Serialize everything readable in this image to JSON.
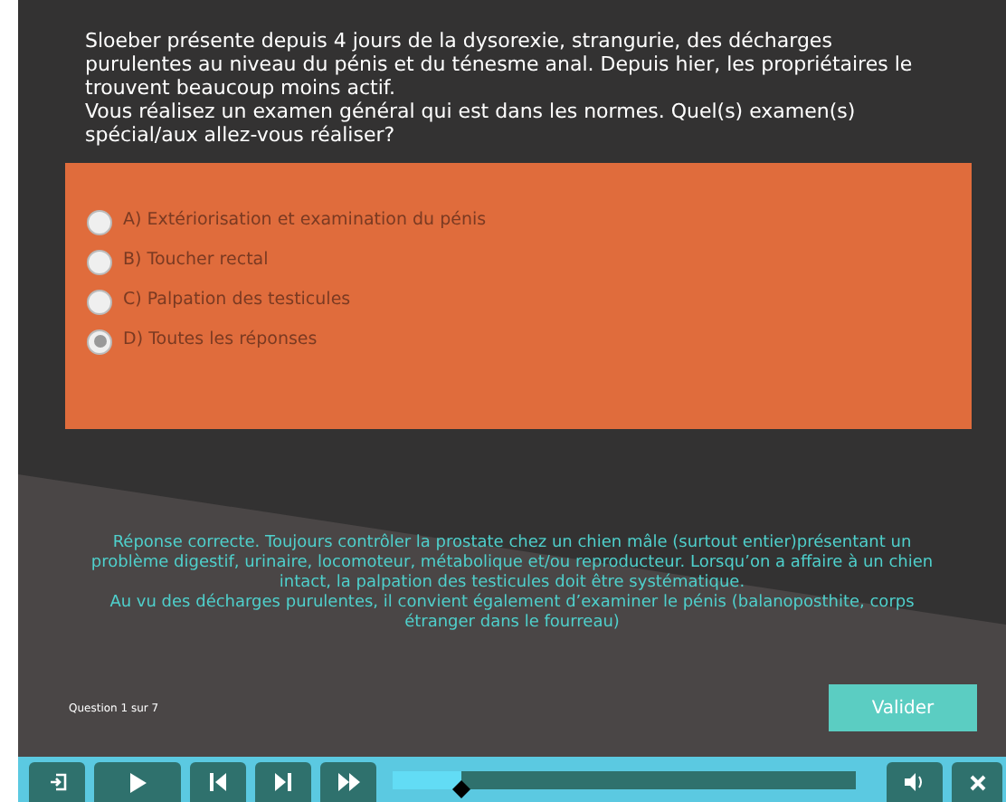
{
  "question": "Sloeber présente depuis 4 jours de la dysorexie, strangurie, des décharges purulentes au niveau du pénis et du ténesme anal. Depuis hier, les propriétaires le trouvent beaucoup moins actif.\nVous réalisez un examen général qui est dans les normes. Quel(s) examen(s) spécial/aux allez-vous réaliser?",
  "options": [
    {
      "letter": "A)",
      "label": "Extériorisation et examination du pénis",
      "selected": false
    },
    {
      "letter": "B)",
      "label": "Toucher rectal",
      "selected": false
    },
    {
      "letter": "C)",
      "label": "Palpation des testicules",
      "selected": false
    },
    {
      "letter": "D)",
      "label": "Toutes les réponses",
      "selected": true
    }
  ],
  "feedback": "Réponse correcte. Toujours contrôler la prostate chez un chien mâle (surtout entier)présentant un problème digestif, urinaire, locomoteur, métabolique et/ou reproducteur. Lorsqu’on a affaire à un chien intact, la palpation des testicules doit être systématique.\nAu vu des décharges purulentes, il convient également d’examiner le pénis (balanoposthite, corps étranger dans le fourreau)",
  "counter": "Question 1 sur 7",
  "submit": "Valider",
  "player": {
    "progress": {
      "level": 0.15
    }
  }
}
